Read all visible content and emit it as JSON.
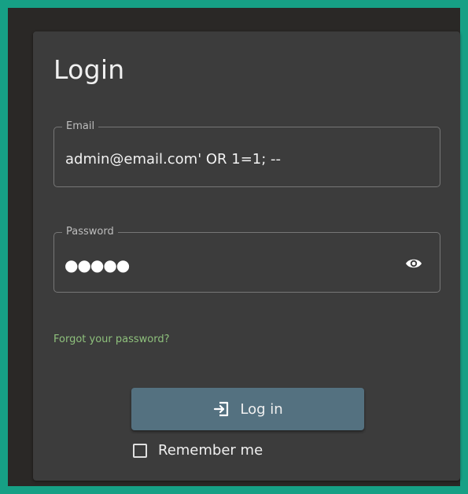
{
  "login": {
    "title": "Login",
    "email": {
      "label": "Email",
      "value": "admin@email.com' OR 1=1; --"
    },
    "password": {
      "label": "Password",
      "masked_value": "●●●●●",
      "toggle_icon": "eye-icon"
    },
    "forgot_link": "Forgot your password?",
    "submit": {
      "label": "Log in",
      "icon": "login-icon"
    },
    "remember_me": {
      "label": "Remember me",
      "checked": false
    }
  },
  "colors": {
    "page_border": "#16a085",
    "card_background": "#3c3c3c",
    "link": "#8ec07c",
    "button": "#547180"
  }
}
